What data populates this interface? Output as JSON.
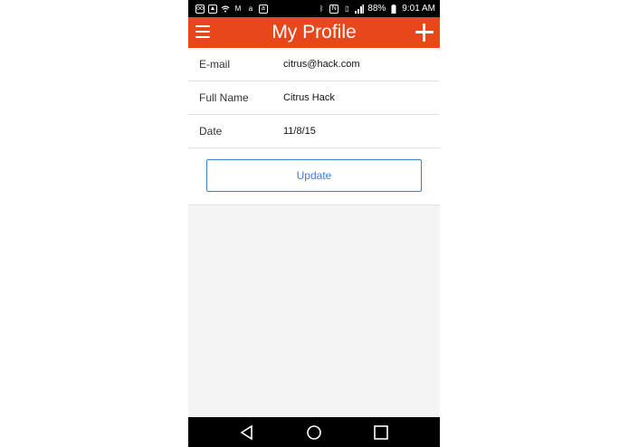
{
  "status_bar": {
    "battery": "88%",
    "time": "9:01 AM",
    "left_icons": [
      "voicemail-icon",
      "image-icon",
      "wifi-icon",
      "gmail-icon",
      "amazon-icon",
      "amazon-box-icon"
    ],
    "right_icons": [
      "bluetooth-icon",
      "nfc-icon",
      "vibrate-icon",
      "signal-icon",
      "battery-icon"
    ]
  },
  "app_bar": {
    "title": "My Profile",
    "left_icon": "menu-icon",
    "right_icon": "add-icon",
    "color": "#e8461b"
  },
  "profile": {
    "rows": [
      {
        "label": "E-mail",
        "value": "citrus@hack.com"
      },
      {
        "label": "Full Name",
        "value": "Citrus Hack"
      },
      {
        "label": "Date",
        "value": "11/8/15"
      }
    ],
    "update_label": "Update",
    "accent": "#3d7fd0"
  },
  "nav_bar": {
    "icons": [
      "back-icon",
      "home-icon",
      "recents-icon"
    ]
  }
}
